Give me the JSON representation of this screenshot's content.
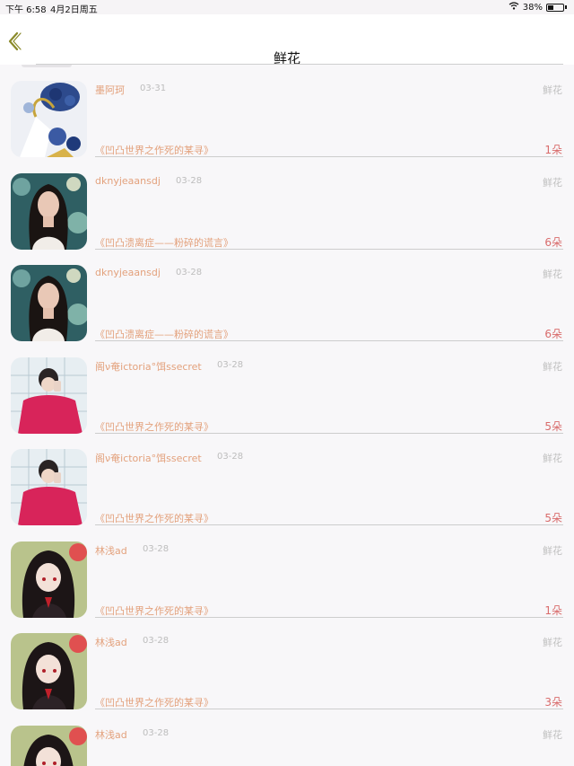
{
  "status_bar": {
    "time": "下午 6:58",
    "date": "4月2日周五",
    "battery": "38%",
    "battery_level": 0.38
  },
  "nav": {
    "title": "鲜花",
    "back_icon": "chevron-left-icon"
  },
  "colors": {
    "accent": "#e3a17c",
    "count": "#d96c6c",
    "date": "#bdbdbd",
    "category": "#c0c0c0",
    "back_arrow": "#8a8a2a"
  },
  "items": [
    {
      "user": "墨阿珂",
      "date": "03-31",
      "category": "鲜花",
      "work": "《凹凸世界之作死的某寻》",
      "count": "1朵",
      "avatar": "flowers"
    },
    {
      "user": "dknyjeaansdj",
      "date": "03-28",
      "category": "鲜花",
      "work": "《凹凸溃离症——粉碎的谎言》",
      "count": "6朵",
      "avatar": "woman"
    },
    {
      "user": "dknyjeaansdj",
      "date": "03-28",
      "category": "鲜花",
      "work": "《凹凸溃离症——粉碎的谎言》",
      "count": "6朵",
      "avatar": "woman"
    },
    {
      "user": "阁ν奄ictoria°饵ssecret",
      "date": "03-28",
      "category": "鲜花",
      "work": "《凹凸世界之作死的某寻》",
      "count": "5朵",
      "avatar": "man-red"
    },
    {
      "user": "阁ν奄ictoria°饵ssecret",
      "date": "03-28",
      "category": "鲜花",
      "work": "《凹凸世界之作死的某寻》",
      "count": "5朵",
      "avatar": "man-red"
    },
    {
      "user": "林浅ad",
      "date": "03-28",
      "category": "鲜花",
      "work": "《凹凸世界之作死的某寻》",
      "count": "1朵",
      "avatar": "anime"
    },
    {
      "user": "林浅ad",
      "date": "03-28",
      "category": "鲜花",
      "work": "《凹凸世界之作死的某寻》",
      "count": "3朵",
      "avatar": "anime"
    },
    {
      "user": "林浅ad",
      "date": "03-28",
      "category": "鲜花",
      "work": "",
      "count": "",
      "avatar": "anime"
    }
  ]
}
